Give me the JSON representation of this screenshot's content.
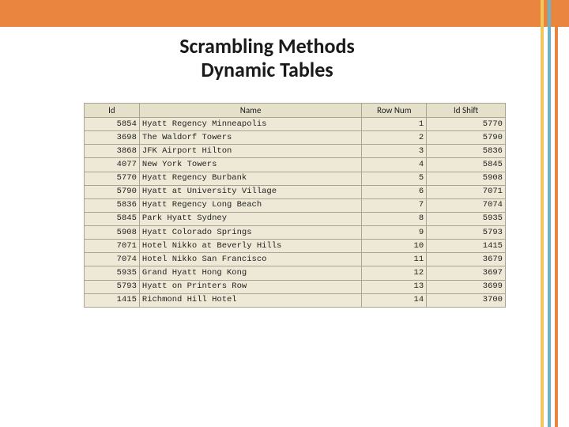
{
  "title": {
    "line1": "Scrambling Methods",
    "line2": "Dynamic Tables"
  },
  "table": {
    "headers": [
      "Id",
      "Name",
      "Row Num",
      "Id Shift"
    ],
    "rows": [
      {
        "id": 5854,
        "name": "Hyatt Regency Minneapolis",
        "row": 1,
        "shift": 5770
      },
      {
        "id": 3698,
        "name": "The Waldorf Towers",
        "row": 2,
        "shift": 5790
      },
      {
        "id": 3868,
        "name": "JFK Airport Hilton",
        "row": 3,
        "shift": 5836
      },
      {
        "id": 4077,
        "name": "New York Towers",
        "row": 4,
        "shift": 5845
      },
      {
        "id": 5770,
        "name": "Hyatt Regency Burbank",
        "row": 5,
        "shift": 5908
      },
      {
        "id": 5790,
        "name": "Hyatt at University Village",
        "row": 6,
        "shift": 7071
      },
      {
        "id": 5836,
        "name": "Hyatt Regency Long Beach",
        "row": 7,
        "shift": 7074
      },
      {
        "id": 5845,
        "name": "Park Hyatt Sydney",
        "row": 8,
        "shift": 5935
      },
      {
        "id": 5908,
        "name": "Hyatt Colorado Springs",
        "row": 9,
        "shift": 5793
      },
      {
        "id": 7071,
        "name": "Hotel Nikko at Beverly Hills",
        "row": 10,
        "shift": 1415
      },
      {
        "id": 7074,
        "name": "Hotel Nikko San Francisco",
        "row": 11,
        "shift": 3679
      },
      {
        "id": 5935,
        "name": "Grand Hyatt Hong Kong",
        "row": 12,
        "shift": 3697
      },
      {
        "id": 5793,
        "name": "Hyatt on Printers Row",
        "row": 13,
        "shift": 3699
      },
      {
        "id": 1415,
        "name": "Richmond Hill Hotel",
        "row": 14,
        "shift": 3700
      }
    ]
  },
  "chart_data": {
    "type": "table",
    "title": "Scrambling Methods Dynamic Tables",
    "columns": [
      "Id",
      "Name",
      "Row Num",
      "Id Shift"
    ],
    "rows": [
      [
        5854,
        "Hyatt Regency Minneapolis",
        1,
        5770
      ],
      [
        3698,
        "The Waldorf Towers",
        2,
        5790
      ],
      [
        3868,
        "JFK Airport Hilton",
        3,
        5836
      ],
      [
        4077,
        "New York Towers",
        4,
        5845
      ],
      [
        5770,
        "Hyatt Regency Burbank",
        5,
        5908
      ],
      [
        5790,
        "Hyatt at University Village",
        6,
        7071
      ],
      [
        5836,
        "Hyatt Regency Long Beach",
        7,
        7074
      ],
      [
        5845,
        "Park Hyatt Sydney",
        8,
        5935
      ],
      [
        5908,
        "Hyatt Colorado Springs",
        9,
        5793
      ],
      [
        7071,
        "Hotel Nikko at Beverly Hills",
        10,
        1415
      ],
      [
        7074,
        "Hotel Nikko San Francisco",
        11,
        3679
      ],
      [
        5935,
        "Grand Hyatt Hong Kong",
        12,
        3697
      ],
      [
        5793,
        "Hyatt on Printers Row",
        13,
        3699
      ],
      [
        1415,
        "Richmond Hill Hotel",
        14,
        3700
      ]
    ]
  }
}
